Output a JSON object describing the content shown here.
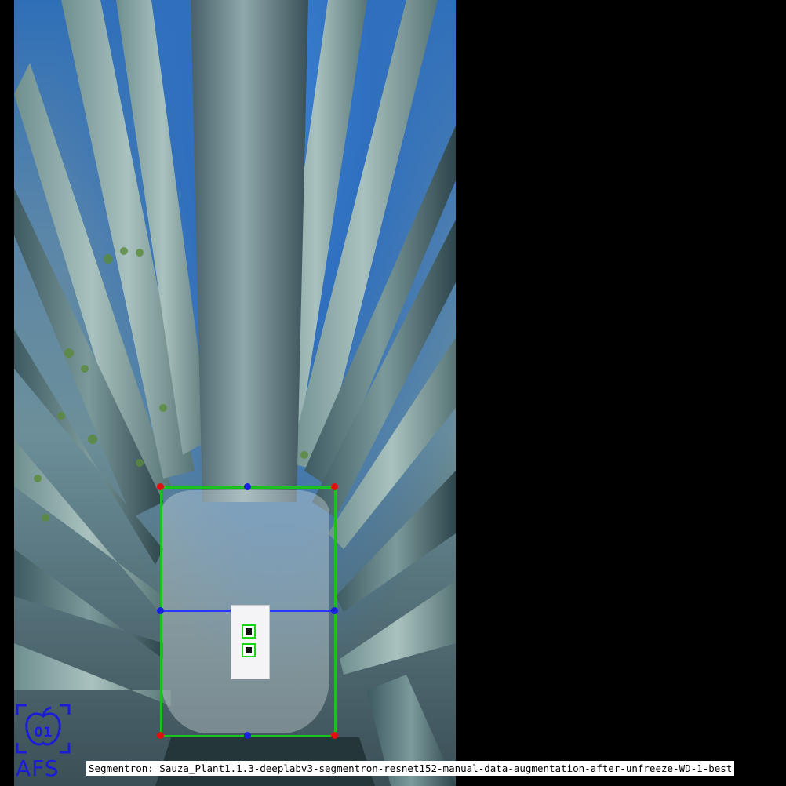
{
  "caption": {
    "text": "Segmentron: Sauza_Plant1.1.3-deeplabv3-segmentron-resnet152-manual-data-augmentation-after-unfreeze-WD-1-best"
  },
  "logo": {
    "text": "AFS",
    "icon": "apple-01-icon",
    "color": "#1b1bd8"
  },
  "overlay": {
    "bbox_color": "#1cc21c",
    "corner_color": "#e01010",
    "midpoint_color": "#1a20e0",
    "line_color": "#2a33ff"
  },
  "marker_card": {
    "text": ""
  }
}
